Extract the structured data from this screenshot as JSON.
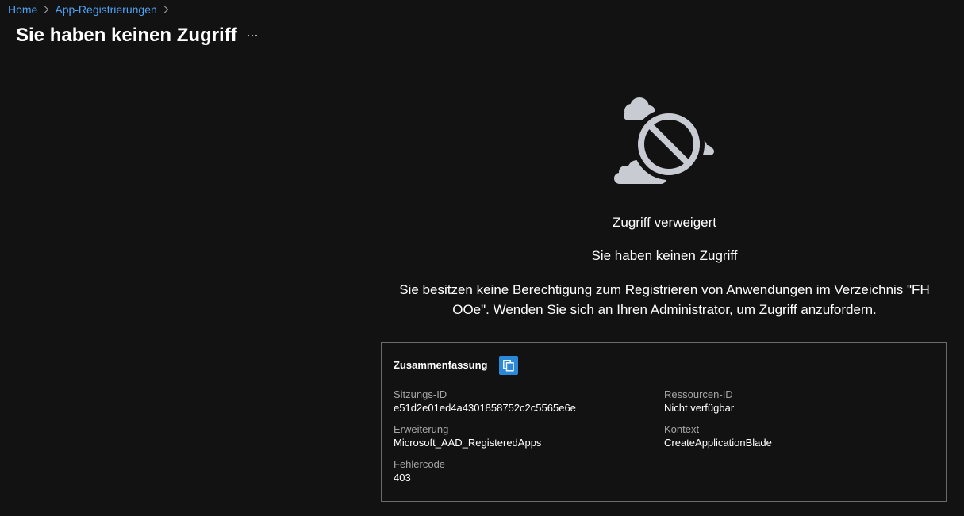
{
  "breadcrumb": {
    "items": [
      {
        "label": "Home"
      },
      {
        "label": "App-Registrierungen"
      }
    ]
  },
  "page": {
    "title": "Sie haben keinen Zugriff",
    "more_label": "···"
  },
  "illustration": {
    "icon": "blocked-cloud-icon",
    "colors": {
      "cloud": "#c8ccd2",
      "block": "#c8ccd2"
    }
  },
  "message": {
    "title": "Zugriff verweigert",
    "subtitle": "Sie haben keinen Zugriff",
    "body_line1": "Sie besitzen keine Berechtigung zum Registrieren von Anwendungen im Verzeichnis \"FH",
    "body_line2": "OOe\". Wenden Sie sich an Ihren Administrator, um Zugriff anzufordern."
  },
  "summary": {
    "title": "Zusammenfassung",
    "copy_icon": "copy-icon",
    "fields": {
      "session_id": {
        "label": "Sitzungs-ID",
        "value": "e51d2e01ed4a4301858752c2c5565e6e"
      },
      "resource_id": {
        "label": "Ressourcen-ID",
        "value": "Nicht verfügbar"
      },
      "extension": {
        "label": "Erweiterung",
        "value": "Microsoft_AAD_RegisteredApps"
      },
      "context": {
        "label": "Kontext",
        "value": "CreateApplicationBlade"
      },
      "error_code": {
        "label": "Fehlercode",
        "value": "403"
      }
    }
  },
  "theme": {
    "background": "#121212",
    "link": "#4fa3f7",
    "accent": "#2b88d8",
    "border": "#6a6a6a",
    "muted_text": "#a6a6a6"
  }
}
